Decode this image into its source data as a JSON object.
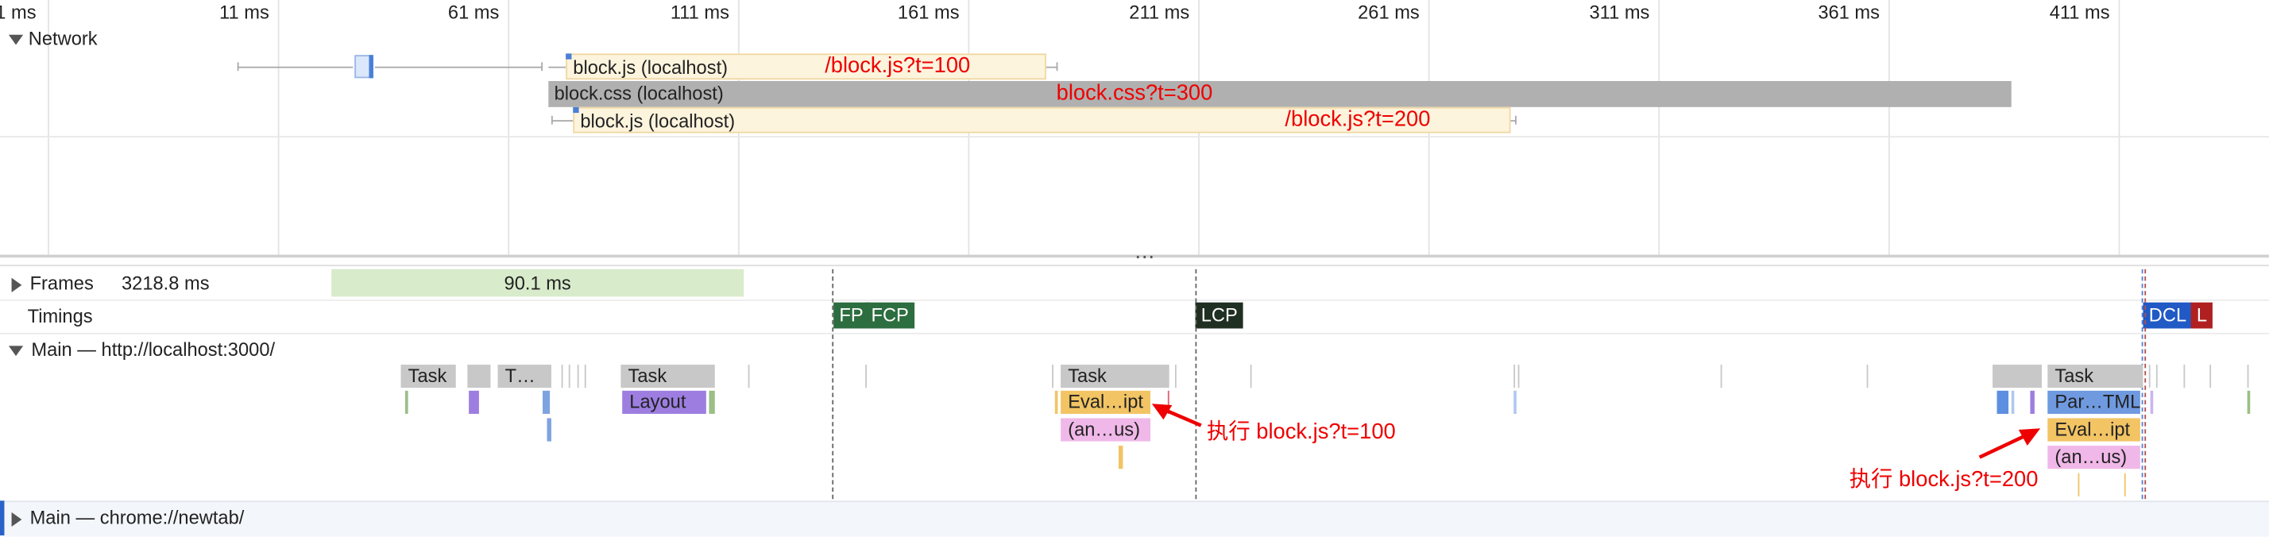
{
  "ruler": {
    "ticks": [
      "1 ms",
      "11 ms",
      "61 ms",
      "111 ms",
      "161 ms",
      "211 ms",
      "261 ms",
      "311 ms",
      "361 ms",
      "411 ms"
    ]
  },
  "network": {
    "title": "Network",
    "requests": [
      {
        "label": "block.js (localhost)",
        "note": "/block.js?t=100"
      },
      {
        "label": "block.css (localhost)",
        "note": "block.css?t=300"
      },
      {
        "label": "block.js (localhost)",
        "note": "/block.js?t=200"
      }
    ]
  },
  "splitter": {
    "glyph": "⋯"
  },
  "frames": {
    "title": "Frames",
    "duration": "3218.8 ms",
    "frame_label": "90.1 ms"
  },
  "timings": {
    "title": "Timings",
    "fp": "FP",
    "fcp": "FCP",
    "lcp": "LCP",
    "dcl": "DCL",
    "l": "L"
  },
  "main": {
    "title": "Main — http://localhost:3000/",
    "task_label": "Task",
    "task_short": "T…",
    "layout_label": "Layout",
    "eval_label": "Eval…ipt",
    "anon_label": "(an…us)",
    "parse_label": "Par…TML",
    "annotation_1": "执行 block.js?t=100",
    "annotation_2": "执行 block.js?t=200"
  },
  "main2": {
    "title": "Main — chrome://newtab/"
  },
  "colors": {
    "js_fill": "#fdf4dd",
    "css_fill": "#b0b0b0",
    "annotation_red": "#ee0000",
    "fp_green": "#2c6e3f",
    "lcp_dark": "#1f2f22",
    "dcl_blue": "#2159c5",
    "load_red": "#b02020",
    "script_yellow": "#f2c464",
    "layout_purple": "#9d7ee0",
    "anon_pink": "#f0b8e8"
  }
}
